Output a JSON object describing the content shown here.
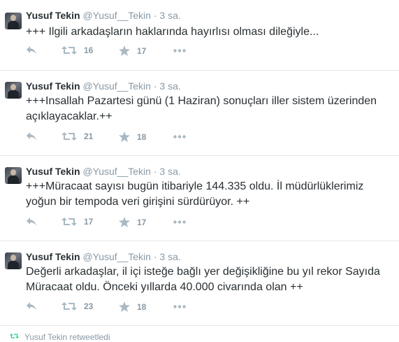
{
  "tweets": [
    {
      "fullname": "Yusuf Tekin",
      "username": "@Yusuf__Tekin",
      "time": "3 sa.",
      "text": "+++ Ilgili arkadaşların haklarında hayırlısı olması dileğiyle...",
      "retweets": "16",
      "favorites": "17"
    },
    {
      "fullname": "Yusuf Tekin",
      "username": "@Yusuf__Tekin",
      "time": "3 sa.",
      "text": "+++Insallah Pazartesi günü (1 Haziran) sonuçları iller sistem üzerinden açıklayacaklar.++",
      "retweets": "21",
      "favorites": "18"
    },
    {
      "fullname": "Yusuf Tekin",
      "username": "@Yusuf__Tekin",
      "time": "3 sa.",
      "text": "+++Müracaat sayısı bugün itibariyle 144.335 oldu. İl müdürlüklerimiz yoğun bir tempoda veri girişini sürdürüyor. ++",
      "retweets": "17",
      "favorites": "17"
    },
    {
      "fullname": "Yusuf Tekin",
      "username": "@Yusuf__Tekin",
      "time": "3 sa.",
      "text": "Değerli arkadaşlar, il içi isteğe bağlı yer değişikliğine bu yıl rekor Sayıda Müracaat oldu. Önceki yıllarda 40.000 civarında olan ++",
      "retweets": "23",
      "favorites": "18"
    }
  ],
  "separator": "·",
  "partial_row": {
    "text": "Yusuf Tekin retweetledi"
  },
  "icons": {
    "reply": "reply-icon",
    "retweet": "retweet-icon",
    "favorite": "star-icon",
    "more": "more-icon"
  },
  "colors": {
    "text": "#292f33",
    "muted": "#8899a6",
    "action": "#aab8c2",
    "divider": "#e1e8ed",
    "retweet_green": "#19cf86"
  }
}
